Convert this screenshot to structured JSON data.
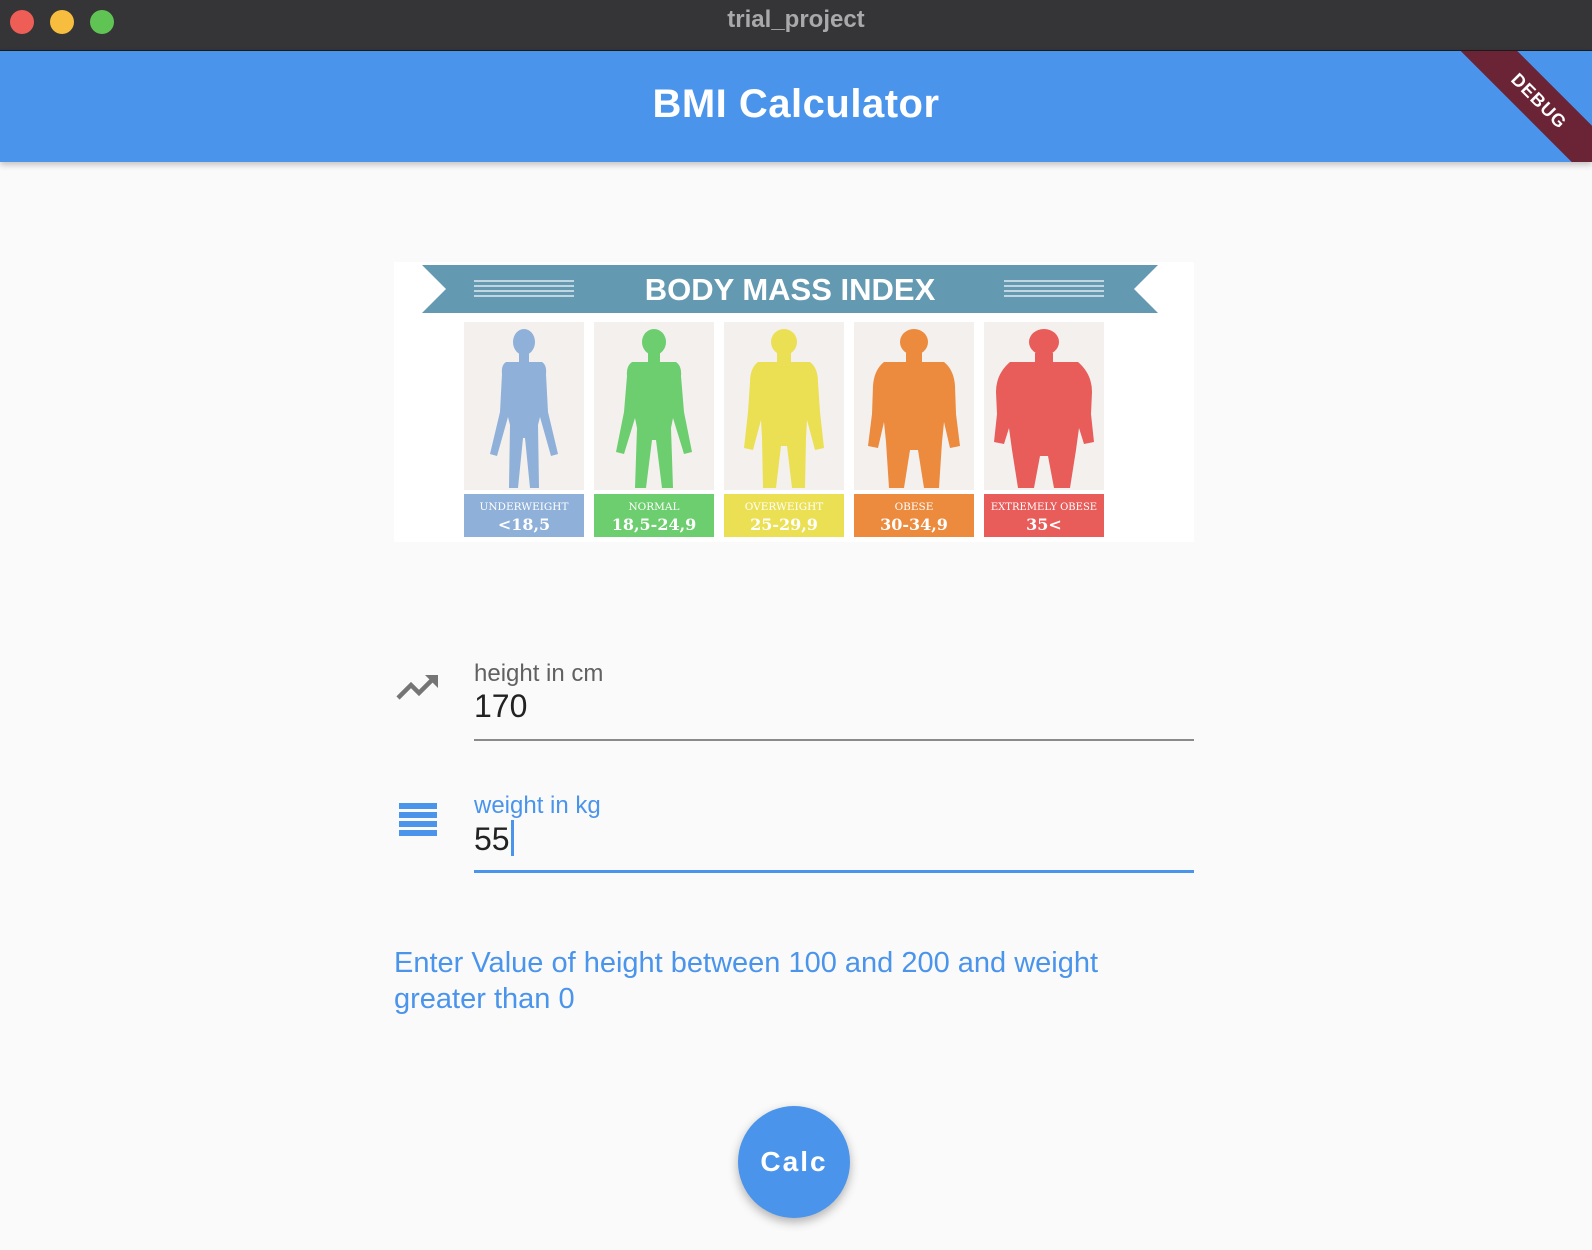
{
  "window": {
    "title": "trial_project"
  },
  "appbar": {
    "title": "BMI Calculator",
    "debug_label": "DEBUG"
  },
  "poster": {
    "heading": "BODY MASS INDEX",
    "categories": [
      {
        "name": "UNDERWEIGHT",
        "range": "<18,5",
        "color": "#8fb0d8"
      },
      {
        "name": "NORMAL",
        "range": "18,5-24,9",
        "color": "#6cce6e"
      },
      {
        "name": "OVERWEIGHT",
        "range": "25-29,9",
        "color": "#ebe054"
      },
      {
        "name": "OBESE",
        "range": "30-34,9",
        "color": "#ec8a3e"
      },
      {
        "name": "EXTREMELY OBESE",
        "range": "35<",
        "color": "#e85c5a"
      }
    ]
  },
  "form": {
    "height": {
      "label": "height in cm",
      "value": "170",
      "icon": "trending-up-icon"
    },
    "weight": {
      "label": "weight in kg",
      "value": "55",
      "icon": "reorder-icon"
    }
  },
  "hint": "Enter Value of height between 100 and 200 and weight greater than 0",
  "calc_button": {
    "label": "Calc"
  },
  "colors": {
    "accent": "#4a94eb",
    "titlebar": "#353437"
  }
}
